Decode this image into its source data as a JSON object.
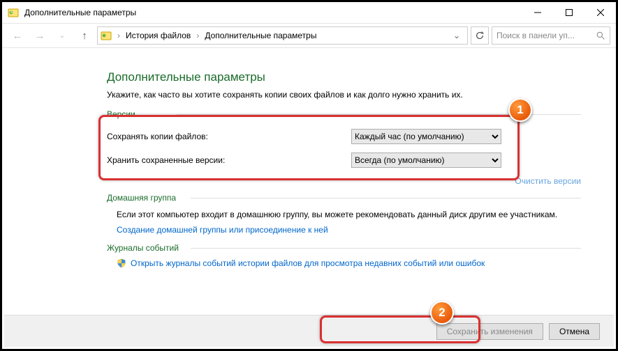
{
  "window": {
    "title": "Дополнительные параметры"
  },
  "breadcrumb": {
    "level1": "История файлов",
    "level2": "Дополнительные параметры"
  },
  "search": {
    "placeholder": "Поиск в панели уп..."
  },
  "page": {
    "heading": "Дополнительные параметры",
    "description": "Укажите, как часто вы хотите сохранять копии своих файлов и как долго нужно хранить их."
  },
  "sections": {
    "versions": {
      "title": "Версии",
      "row1_label": "Сохранять копии файлов:",
      "row1_value": "Каждый час (по умолчанию)",
      "row2_label": "Хранить сохраненные версии:",
      "row2_value": "Всегда (по умолчанию)",
      "clean_link": "Очистить версии"
    },
    "homegroup": {
      "title": "Домашняя группа",
      "text": "Если этот компьютер входит в домашнюю группу, вы можете рекомендовать данный диск другим ее участникам.",
      "link": "Создание домашней группы или присоединение к ней"
    },
    "logs": {
      "title": "Журналы событий",
      "link": "Открыть журналы событий истории файлов для просмотра недавних событий или ошибок"
    }
  },
  "footer": {
    "save": "Сохранить изменения",
    "cancel": "Отмена"
  },
  "callouts": {
    "c1": "1",
    "c2": "2"
  }
}
